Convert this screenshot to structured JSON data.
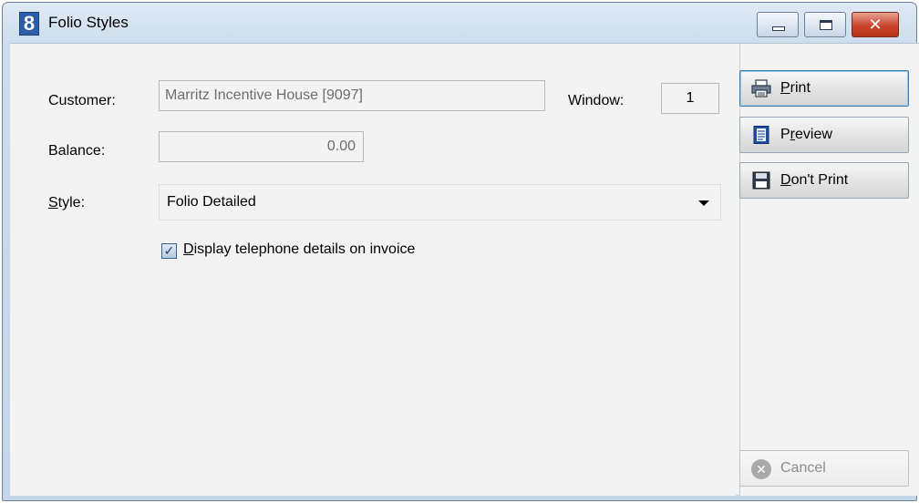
{
  "window": {
    "title": "Folio Styles",
    "app_icon_glyph": "8",
    "close_glyph": "✕"
  },
  "form": {
    "customer_label": "Customer:",
    "customer_value": "Marritz Incentive House [9097]",
    "window_label": "Window:",
    "window_value": "1",
    "balance_label": "Balance:",
    "balance_value": "0.00",
    "style_label_first": "S",
    "style_label_rest": "tyle:",
    "style_value": "Folio Detailed",
    "display_tel_checked": true,
    "display_tel_first": "D",
    "display_tel_rest": "isplay telephone details on invoice"
  },
  "buttons": {
    "print_first": "P",
    "print_rest": "rint",
    "preview_first": "P",
    "preview_mid": "r",
    "preview_rest": "eview",
    "dontprint_first": "D",
    "dontprint_rest": "on't Print",
    "cancel_label": "Cancel"
  },
  "icons": {
    "print": "printer-icon",
    "preview": "document-preview-icon",
    "dontprint": "floppy-disk-icon",
    "cancel": "cancel-x-icon",
    "checkmark": "✓",
    "cancel_glyph": "✕"
  },
  "colors": {
    "title_accent": "#2d5da8",
    "close_button": "#c9442c"
  }
}
